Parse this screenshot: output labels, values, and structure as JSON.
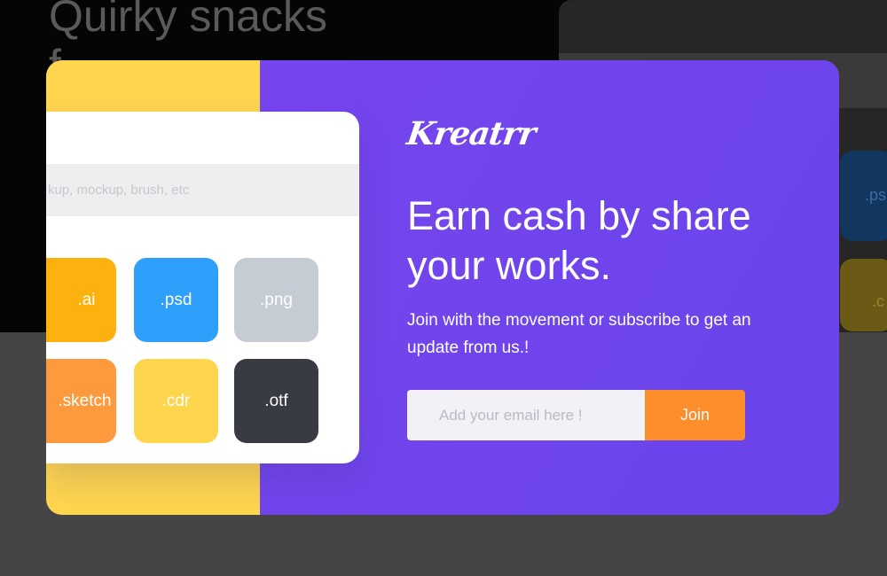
{
  "background": {
    "heading_line1": "Quirky snacks",
    "heading_line2": "f",
    "tile_blue_label": ".ps",
    "tile_yellow_label": ".c"
  },
  "modal": {
    "preview": {
      "search_text": "kup, mockup, brush, etc",
      "tiles": [
        {
          "label": ".ai",
          "color": "#fcb10e"
        },
        {
          "label": ".psd",
          "color": "#2f9ffc"
        },
        {
          "label": ".png",
          "color": "#c6ccd3"
        },
        {
          "label": ".sketch",
          "color": "#fd9a3d"
        },
        {
          "label": ".cdr",
          "color": "#fed64e"
        },
        {
          "label": ".otf",
          "color": "#383b42"
        }
      ]
    },
    "brand": {
      "logo": "Kreatrr"
    },
    "headline": "Earn cash by share your works.",
    "subtext": "Join with the movement or subscribe to get an update from us.!",
    "form": {
      "email_placeholder": "Add your email here !",
      "email_value": "",
      "join_label": "Join"
    },
    "colors": {
      "left_panel": "#fed64e",
      "right_panel": "#7044ec",
      "accent_button": "#fe8d2c"
    }
  }
}
